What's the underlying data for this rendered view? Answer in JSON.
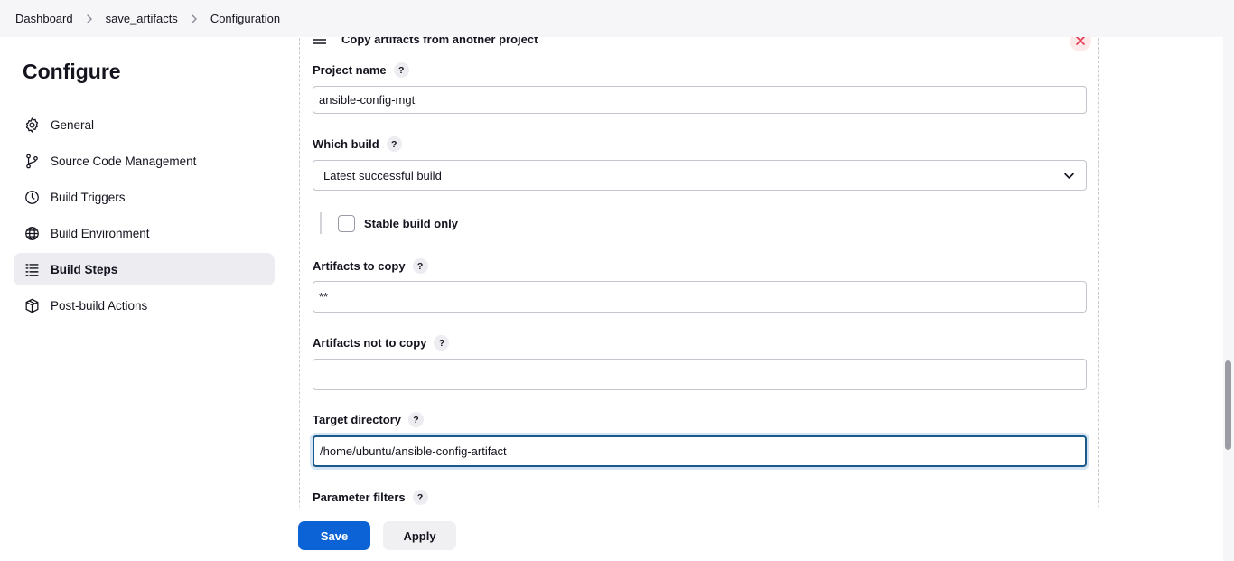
{
  "breadcrumb": {
    "items": [
      "Dashboard",
      "save_artifacts",
      "Configuration"
    ]
  },
  "sidebar": {
    "title": "Configure",
    "items": [
      {
        "label": "General",
        "icon": "gear-icon"
      },
      {
        "label": "Source Code Management",
        "icon": "branch-icon"
      },
      {
        "label": "Build Triggers",
        "icon": "clock-icon"
      },
      {
        "label": "Build Environment",
        "icon": "globe-icon"
      },
      {
        "label": "Build Steps",
        "icon": "list-icon",
        "active": true
      },
      {
        "label": "Post-build Actions",
        "icon": "package-icon"
      }
    ]
  },
  "step": {
    "title": "Copy artifacts from another project",
    "help_glyph": "?",
    "project_name": {
      "label": "Project name",
      "value": "ansible-config-mgt"
    },
    "which_build": {
      "label": "Which build",
      "selected": "Latest successful build"
    },
    "stable_build_only": {
      "label": "Stable build only",
      "checked": false
    },
    "artifacts_to_copy": {
      "label": "Artifacts to copy",
      "value": "**"
    },
    "artifacts_not_to_copy": {
      "label": "Artifacts not to copy",
      "value": ""
    },
    "target_directory": {
      "label": "Target directory",
      "value": "/home/ubuntu/ansible-config-artifact"
    },
    "parameter_filters": {
      "label": "Parameter filters"
    }
  },
  "actions": {
    "save_label": "Save",
    "apply_label": "Apply"
  },
  "colors": {
    "primary": "#0b63d6",
    "danger": "#e5394d",
    "active_bg": "#ececf1",
    "focus_border": "#1a5a8a"
  }
}
